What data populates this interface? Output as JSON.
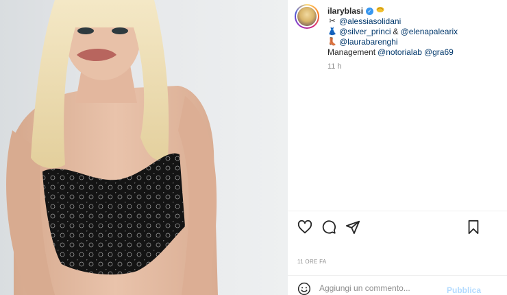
{
  "post": {
    "username": "ilaryblasi",
    "verified_mark": "✓",
    "caption_lines": [
      {
        "icon": "scissors-comb-icon",
        "emoji": "✂",
        "mentions": [
          "@alessiasolidani"
        ]
      },
      {
        "icon": "dress-icon",
        "emoji": "👗",
        "mentions": [
          "@silver_princi",
          "@elenapalearix"
        ],
        "joiner": "&"
      },
      {
        "icon": "boot-icon",
        "emoji": "👢",
        "mentions": [
          "@laurabarenghi"
        ]
      }
    ],
    "management_label": "Management",
    "management_mentions": [
      "@notorialab",
      "@gra69"
    ],
    "relative_time": "11 h",
    "date_label": "11 ORE FA"
  },
  "actions": {
    "like_icon": "heart-icon",
    "comment_icon": "comment-bubble-icon",
    "share_icon": "paper-plane-icon",
    "save_icon": "bookmark-icon"
  },
  "comment_box": {
    "emoji_icon": "smiley-icon",
    "placeholder": "Aggiungi un commento...",
    "publish_label": "Pubblica",
    "publish_color": "#b3dbff"
  },
  "colors": {
    "mention": "#00376b",
    "muted": "#8e8e8e",
    "verified": "#3897f0"
  }
}
